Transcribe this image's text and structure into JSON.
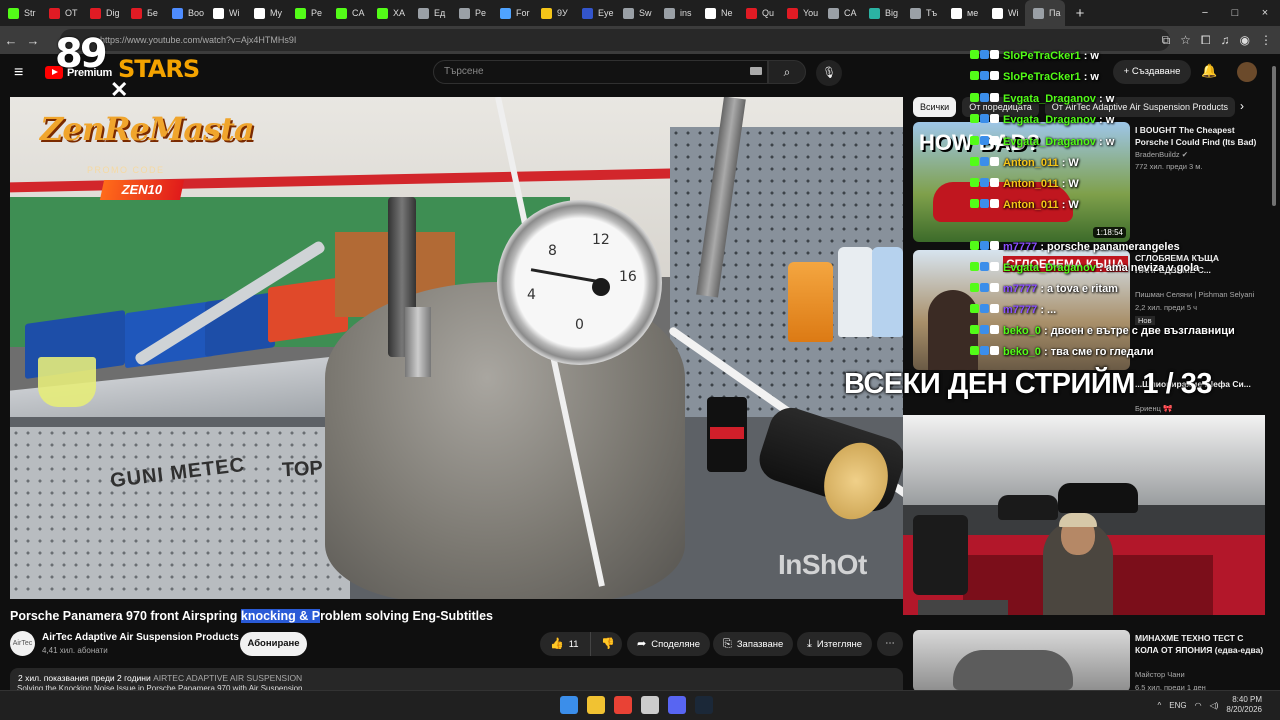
{
  "browser": {
    "tabs": [
      {
        "label": "Str",
        "color": "#53fc18"
      },
      {
        "label": "OT",
        "color": "#e01b24"
      },
      {
        "label": "Dig",
        "color": "#e01b24"
      },
      {
        "label": "Бе",
        "color": "#e01b24"
      },
      {
        "label": "Boo",
        "color": "#4e8cff"
      },
      {
        "label": "Wi",
        "color": "#ffffff"
      },
      {
        "label": "My",
        "color": "#ffffff"
      },
      {
        "label": "Pe",
        "color": "#53fc18"
      },
      {
        "label": "CA",
        "color": "#53fc18"
      },
      {
        "label": "XA",
        "color": "#53fc18"
      },
      {
        "label": "Ед",
        "color": "#9aa0a6"
      },
      {
        "label": "Pe",
        "color": "#9aa0a6"
      },
      {
        "label": "For",
        "color": "#4fa3ff"
      },
      {
        "label": "9У",
        "color": "#f5c518"
      },
      {
        "label": "Eye",
        "color": "#3355cc"
      },
      {
        "label": "Sw",
        "color": "#9aa0a6"
      },
      {
        "label": "ins",
        "color": "#9aa0a6"
      },
      {
        "label": "Ne",
        "color": "#ffffff"
      },
      {
        "label": "Qu",
        "color": "#e01b24"
      },
      {
        "label": "You",
        "color": "#e01b24"
      },
      {
        "label": "CA",
        "color": "#9aa0a6"
      },
      {
        "label": "Big",
        "color": "#2bb3a3"
      },
      {
        "label": "Тъ",
        "color": "#9aa0a6"
      },
      {
        "label": "ме",
        "color": "#ffffff"
      },
      {
        "label": "Wi",
        "color": "#ffffff"
      },
      {
        "label": "Па",
        "color": "#9aa0a6"
      }
    ],
    "active_tab_label": "×",
    "new_tab": "+",
    "window_controls": [
      "−",
      "□",
      "×"
    ],
    "url": "https://www.youtube.com/watch?v=Ajx4HTMHs9I",
    "back": "←",
    "forward": "→",
    "reload": "⟳"
  },
  "header": {
    "menu_icon": "≡",
    "brand": "Premium",
    "search_placeholder": "Търсене",
    "search_icon": "⌕",
    "mic_icon": "🎙",
    "create_label": "+ Създаване",
    "bell_icon": "🔔"
  },
  "overlay": {
    "stars_number": "89",
    "stars_text": "STARS",
    "promo_name": "ZenReMasta",
    "promo_sub": "PROMO CODE",
    "promo_code": "ZEN10",
    "cross": "✕",
    "stream_banner": "ВСЕКИ ДЕН СТРИЙМ 1 / 33"
  },
  "video": {
    "gauge_numbers": [
      "8",
      "12",
      "4",
      "16",
      "0"
    ],
    "sticker1": "GUNI METEC",
    "sticker2": "TOP GUN",
    "watermark": "InShOt",
    "title_part1": "Porsche Panamera 970 front Airspring ",
    "title_highlight": "knocking & P",
    "title_part2": "roblem solving Eng-Subtitles",
    "channel_name": "AirTec Adaptive Air Suspension Products",
    "channel_avatar_text": "AirTec",
    "subscribers": "4,41 хил. абонати",
    "subscribe_label": "Абониране",
    "likes": "11",
    "like_icon": "👍",
    "dislike_icon": "👎",
    "share_label": "Споделяне",
    "save_label": "Запазване",
    "download_label": "Изтегляне",
    "more_icon": "⋯",
    "views_date": "2 хил. показвания  преди 2 години ",
    "channel_tag": "AIRTEC ADAPTIVE AIR SUSPENSION",
    "desc_line2": "Solving the Knocking Noise Issue in Porsche Panamera 970 with Air Suspension..."
  },
  "sidebar": {
    "chips": [
      "Всички",
      "От поредицата",
      "От AirTec Adaptive Air Suspension Products"
    ],
    "chip_arrow": "›",
    "recs": [
      {
        "title": "I BOUGHT The Cheapest Porsche I Could Find (Its Bad)",
        "channel": "BradenBuildz ✔",
        "meta": "772 хил.  преди 3 м.",
        "duration": "1:18:54",
        "thumb_text": "HOW BAD?"
      },
      {
        "title": "СГЛОБЯЕМА КЪЩА НАПРЕДВАМЕ С...",
        "channel": "Пишман Селяни | Pishman Selyani",
        "meta": "2,2 хил.  преди 5 ч",
        "badge": "Нов",
        "thumb_text": "СГЛОБЯЕМА КЪЩА"
      },
      {
        "title": "...Шпионирахме Шефа Си...",
        "channel": "Бриенц 🎀",
        "meta": ""
      },
      {
        "title": "МИНАХМЕ ТЕХНО ТЕСТ С КОЛА ОТ ЯПОНИЯ (едва-едва)",
        "channel": "Майстор Чани",
        "meta": "6,5 хил.  преди 1 ден"
      }
    ]
  },
  "chat": [
    {
      "user": "SloPeTraCker1",
      "msg": " : w",
      "color": "#53fc18"
    },
    {
      "user": "SloPeTraCker1",
      "msg": " : w",
      "color": "#53fc18"
    },
    {
      "user": "Evgata_Draganov",
      "msg": " : w",
      "color": "#53fc18"
    },
    {
      "user": "Evgata_Draganov",
      "msg": " : w",
      "color": "#53fc18"
    },
    {
      "user": "Evgata_Draganov",
      "msg": " : w",
      "color": "#53fc18"
    },
    {
      "user": "Anton_011",
      "msg": " : W",
      "color": "#f5c518"
    },
    {
      "user": "Anton_011",
      "msg": " : W",
      "color": "#f5c518"
    },
    {
      "user": "Anton_011",
      "msg": " : W",
      "color": "#f5c518"
    },
    {
      "user": "m7777",
      "msg": " : porsche panamerangeles",
      "color": "#8a4fff"
    },
    {
      "user": "Evgata_Draganov",
      "msg": " : ama neviza v gola",
      "color": "#53fc18"
    },
    {
      "user": "m7777",
      "msg": " : a tova e ritam",
      "color": "#8a4fff"
    },
    {
      "user": "m7777",
      "msg": " : ...",
      "color": "#8a4fff"
    },
    {
      "user": "beko_0",
      "msg": " : двоен е вътре с две възглавници",
      "color": "#53fc18"
    },
    {
      "user": "beko_0",
      "msg": " : тва сме го гледали",
      "color": "#53fc18"
    }
  ],
  "taskbar": {
    "icons": [
      "#3b8eea",
      "#f1c232",
      "#e94235",
      "#cccccc",
      "#5865f2",
      "#1b2838"
    ],
    "lang": "ENG",
    "time": "8:40 PM",
    "date": "8/20/2026"
  },
  "colors": {
    "accent": "#ff0000",
    "highlight": "#2a5bd7"
  }
}
